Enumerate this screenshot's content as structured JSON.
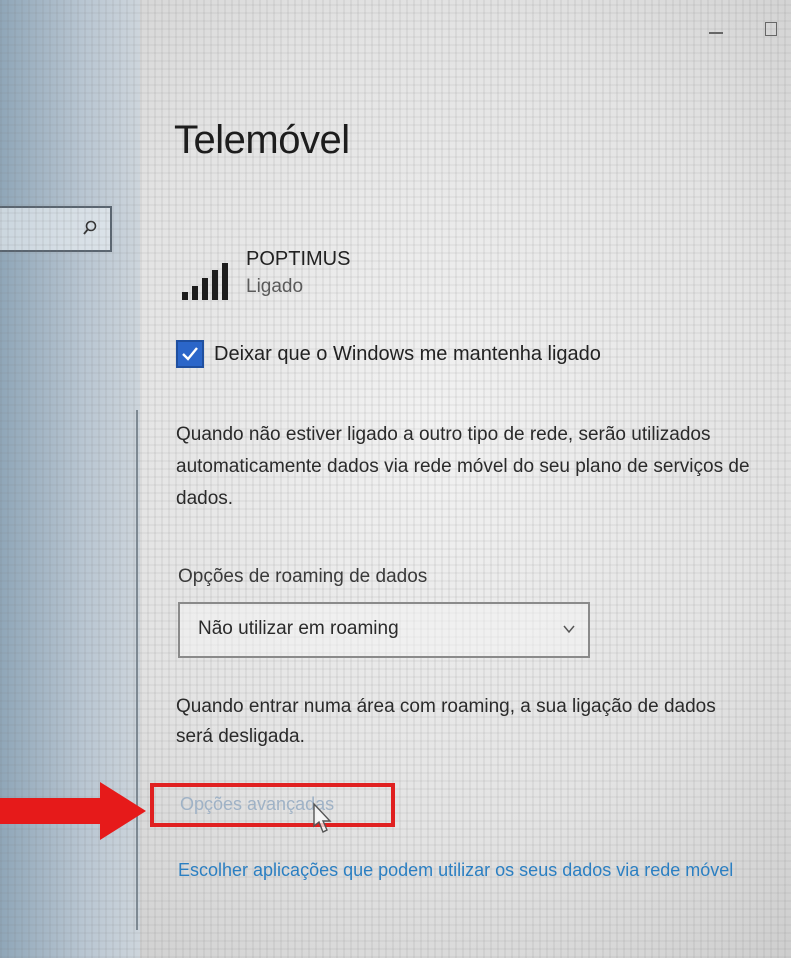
{
  "window": {
    "title": "Telemóvel"
  },
  "network": {
    "name": "POPTIMUS",
    "status": "Ligado",
    "icon": "signal-bars-icon"
  },
  "auto_connect": {
    "label": "Deixar que o Windows me mantenha ligado",
    "checked": true
  },
  "description": {
    "line1": "Quando não estiver ligado a outro tipo de rede, serão utilizados",
    "line2": "automaticamente dados via rede móvel do seu plano de serviços de",
    "line3": "dados."
  },
  "roaming": {
    "label": "Opções de roaming de dados",
    "selected": "Não utilizar em roaming",
    "note_line1": "Quando entrar numa área com roaming, a sua ligação de dados",
    "note_line2": "será desligada."
  },
  "links": {
    "advanced": "Opções avançadas",
    "apps": "Escolher aplicações que podem utilizar os seus dados via rede móvel"
  },
  "colors": {
    "accent": "#2b66c9",
    "annotation": "#e02020",
    "link": "#2b7fc2"
  }
}
